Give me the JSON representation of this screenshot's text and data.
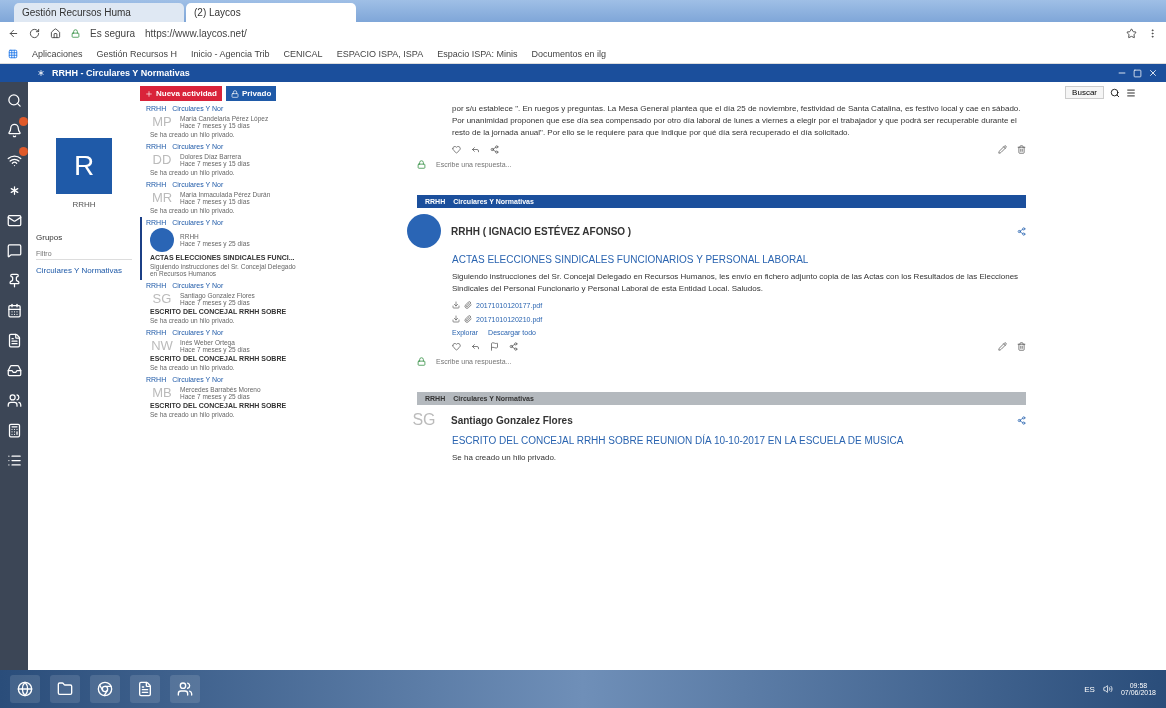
{
  "browser": {
    "tabs": [
      {
        "label": "Gestión Recursos Huma",
        "selected": false
      },
      {
        "label": "(2) Laycos",
        "selected": true
      }
    ],
    "secure_label": "Es segura",
    "url": "https://www.laycos.net/",
    "bookmarks": [
      "Aplicaciones",
      "Gestión Recursos H",
      "Inicio - Agencia Trib",
      "CENICAL",
      "ESPACIO ISPA, ISPA",
      "Espacio ISPA: Minis",
      "Documentos en ilg"
    ]
  },
  "app": {
    "title": "RRHH - Circulares Y Normativas"
  },
  "rail": [
    {
      "kind": "search",
      "alert": false
    },
    {
      "kind": "bell",
      "alert": true
    },
    {
      "kind": "signal",
      "alert": true
    },
    {
      "kind": "asterisk",
      "alert": false
    },
    {
      "kind": "mail",
      "alert": false
    },
    {
      "kind": "chat",
      "alert": false
    },
    {
      "kind": "pin",
      "alert": false
    },
    {
      "kind": "calendar",
      "alert": false
    },
    {
      "kind": "document",
      "alert": false
    },
    {
      "kind": "inbox",
      "alert": false
    },
    {
      "kind": "users",
      "alert": false
    },
    {
      "kind": "calculator",
      "alert": false
    },
    {
      "kind": "list",
      "alert": false
    }
  ],
  "profile": {
    "initial": "R",
    "name": "RRHH",
    "groups_title": "Grupos",
    "filter_placeholder": "Filtro",
    "groups": [
      {
        "label": "Circulares Y Normativas",
        "selected": true
      }
    ]
  },
  "toolbar": {
    "new_button": "Nueva actividad",
    "private_button": "Privado"
  },
  "feed": [
    {
      "group": "RRHH",
      "channel": "Circulares Y Nor",
      "initials": "MP",
      "name": "María Candelaria Pérez López",
      "time": "Hace 7 meses y 15 días",
      "note": "Se ha creado un hilo privado.",
      "selected": false
    },
    {
      "group": "RRHH",
      "channel": "Circulares Y Nor",
      "initials": "DD",
      "name": "Dolores Díaz Barrera",
      "time": "Hace 7 meses y 15 días",
      "note": "Se ha creado un hilo privado.",
      "selected": false
    },
    {
      "group": "RRHH",
      "channel": "Circulares Y Nor",
      "initials": "MR",
      "name": "María Inmaculada Pérez Durán",
      "time": "Hace 7 meses y 15 días",
      "note": "Se ha creado un hilo privado.",
      "selected": false
    },
    {
      "group": "RRHH",
      "channel": "Circulares Y Nor",
      "name": "RRHH",
      "time": "Hace 7 meses y 25 días",
      "title": "ACTAS ELECCIONES SINDICALES FUNCI...",
      "note": "Siguiendo instrucciones del Sr. Concejal Delegado en Recursos Humanos",
      "selected": true
    },
    {
      "group": "RRHH",
      "channel": "Circulares Y Nor",
      "initials": "SG",
      "name": "Santiago Gonzalez Flores",
      "time": "Hace 7 meses y 25 días",
      "title": "ESCRITO DEL CONCEJAL RRHH SOBRE",
      "note": "Se ha creado un hilo privado.",
      "selected": false
    },
    {
      "group": "RRHH",
      "channel": "Circulares Y Nor",
      "initials": "NW",
      "name": "Inés Weber Ortega",
      "time": "Hace 7 meses y 25 días",
      "title": "ESCRITO DEL CONCEJAL RRHH SOBRE",
      "note": "Se ha creado un hilo privado.",
      "selected": false
    },
    {
      "group": "RRHH",
      "channel": "Circulares Y Nor",
      "initials": "MB",
      "name": "Mercedes Barrabés Moreno",
      "time": "Hace 7 meses y 25 días",
      "title": "ESCRITO DEL CONCEJAL RRHH SOBRE",
      "note": "Se ha creado un hilo privado.",
      "selected": false
    }
  ],
  "main": {
    "search_button": "Buscar",
    "intro_text": "por s/u establece \". En ruegos y preguntas. La Mesa General plantea que el día 25 de noviembre, festividad de Santa Catalina, es festivo local y cae en sábado. Por unanimidad proponen que ese día sea compensado por otro día laboral de lunes a viernes a elegir por el trabajador y que podrá ser recuperable durante el resto de la jornada anual\". Por ello se le requiere para que indique por qué día será recuperado el día solicitado.",
    "reply_placeholder": "Escribe una respuesta...",
    "posts": [
      {
        "group": "RRHH",
        "channel": "Circulares Y Normativas",
        "faded": false,
        "author": "RRHH ( IGNACIO ESTÉVEZ AFONSO )",
        "title": "ACTAS ELECCIONES SINDICALES FUNCIONARIOS Y PERSONAL LABORAL",
        "body": "Siguiendo instrucciones del Sr. Concejal Delegado en Recursos Humanos, les envío en fichero adjunto copia de las Actas con los Resultados de las Elecciones Sindicales del Personal Funcionario y Personal Laboral de esta Entidad Local. Saludos.",
        "attachments": [
          "20171010120177.pdf",
          "20171010120210.pdf"
        ],
        "links": [
          "Explorar",
          "Descargar todo"
        ],
        "reply_placeholder": "Escribe una respuesta..."
      },
      {
        "group": "RRHH",
        "channel": "Circulares Y Normativas",
        "faded": true,
        "initials": "SG",
        "author": "Santiago Gonzalez Flores",
        "title": "ESCRITO DEL CONCEJAL RRHH SOBRE REUNION DÍA 10-10-2017 EN LA ESCUELA DE MUSICA",
        "body": "Se ha creado un hilo privado."
      }
    ]
  },
  "taskbar": {
    "language": "ES",
    "time": "09:58",
    "date": "07/06/2018"
  }
}
